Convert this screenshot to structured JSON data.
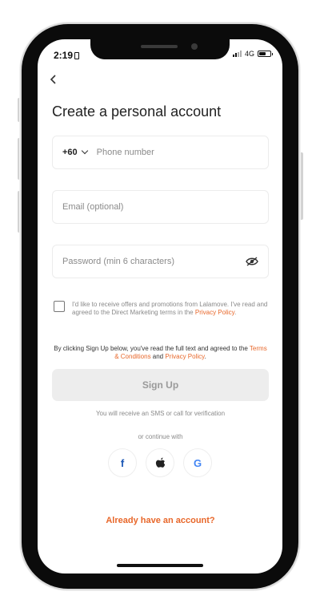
{
  "status_bar": {
    "time": "2:19",
    "network": "4G"
  },
  "page": {
    "title": "Create a personal account"
  },
  "phone_field": {
    "country_code": "+60",
    "placeholder": "Phone number"
  },
  "email_field": {
    "placeholder": "Email (optional)"
  },
  "password_field": {
    "placeholder": "Password (min 6 characters)"
  },
  "consent": {
    "text": "I'd like to receive offers and promotions from Lalamove. I've read and agreed to the Direct Marketing terms in the ",
    "link": "Privacy Policy",
    "suffix": "."
  },
  "terms": {
    "prefix": "By clicking Sign Up below, you've read the full text and agreed to the ",
    "terms_link": "Terms & Conditions",
    "and": " and ",
    "privacy_link": "Privacy Policy",
    "suffix": "."
  },
  "signup_button": {
    "label": "Sign Up"
  },
  "sms_note": "You will receive an SMS or call for verification",
  "continue_with": "or continue with",
  "social": {
    "facebook": "f",
    "google": "G"
  },
  "login_link": "Already have an account?",
  "colors": {
    "accent": "#e8672a",
    "facebook": "#1b57b5"
  }
}
